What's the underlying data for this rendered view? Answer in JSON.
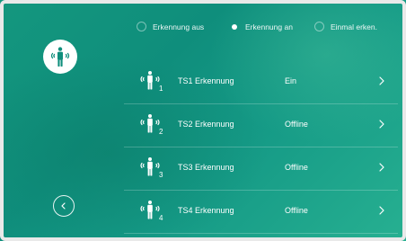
{
  "mode_options": [
    {
      "label": "Erkennung aus",
      "selected": false
    },
    {
      "label": "Erkennung an",
      "selected": true
    },
    {
      "label": "Einmal erken.",
      "selected": false
    }
  ],
  "main_icon": "person-detection-icon",
  "back_icon": "chevron-left-icon",
  "items": [
    {
      "icon": "person-detection-icon",
      "number": "1",
      "label": "TS1 Erkennung",
      "status": "Ein"
    },
    {
      "icon": "person-detection-icon",
      "number": "2",
      "label": "TS2 Erkennung",
      "status": "Offline"
    },
    {
      "icon": "person-detection-icon",
      "number": "3",
      "label": "TS3 Erkennung",
      "status": "Offline"
    },
    {
      "icon": "person-detection-icon",
      "number": "4",
      "label": "TS4 Erkennung",
      "status": "Offline"
    }
  ],
  "colors": {
    "background_start": "#14977e",
    "background_end": "#27b091",
    "icon_fill": "#0f8e7c",
    "text": "#ffffff"
  }
}
